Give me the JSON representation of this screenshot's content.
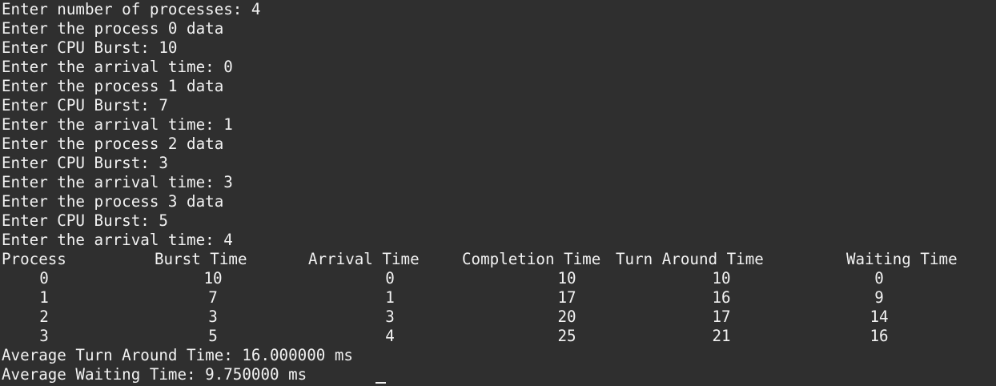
{
  "terminal": {
    "input_lines": [
      "Enter number of processes: 4",
      "Enter the process 0 data",
      "Enter CPU Burst: 10",
      "Enter the arrival time: 0",
      "Enter the process 1 data",
      "Enter CPU Burst: 7",
      "Enter the arrival time: 1",
      "Enter the process 2 data",
      "Enter CPU Burst: 3",
      "Enter the arrival time: 3",
      "Enter the process 3 data",
      "Enter CPU Burst: 5",
      "Enter the arrival time: 4"
    ],
    "table": {
      "headers": [
        "Process",
        "Burst Time",
        "Arrival Time",
        "Completion Time",
        "Turn Around Time",
        "Waiting Time"
      ],
      "rows": [
        [
          "0",
          "10",
          "0",
          "10",
          "10",
          "0"
        ],
        [
          "1",
          "7",
          "1",
          "17",
          "16",
          "9"
        ],
        [
          "2",
          "3",
          "3",
          "20",
          "17",
          "14"
        ],
        [
          "3",
          "5",
          "4",
          "25",
          "21",
          "16"
        ]
      ]
    },
    "summary_lines": [
      "Average Turn Around Time: 16.000000 ms",
      "Average Waiting Time: 9.750000 ms"
    ]
  }
}
